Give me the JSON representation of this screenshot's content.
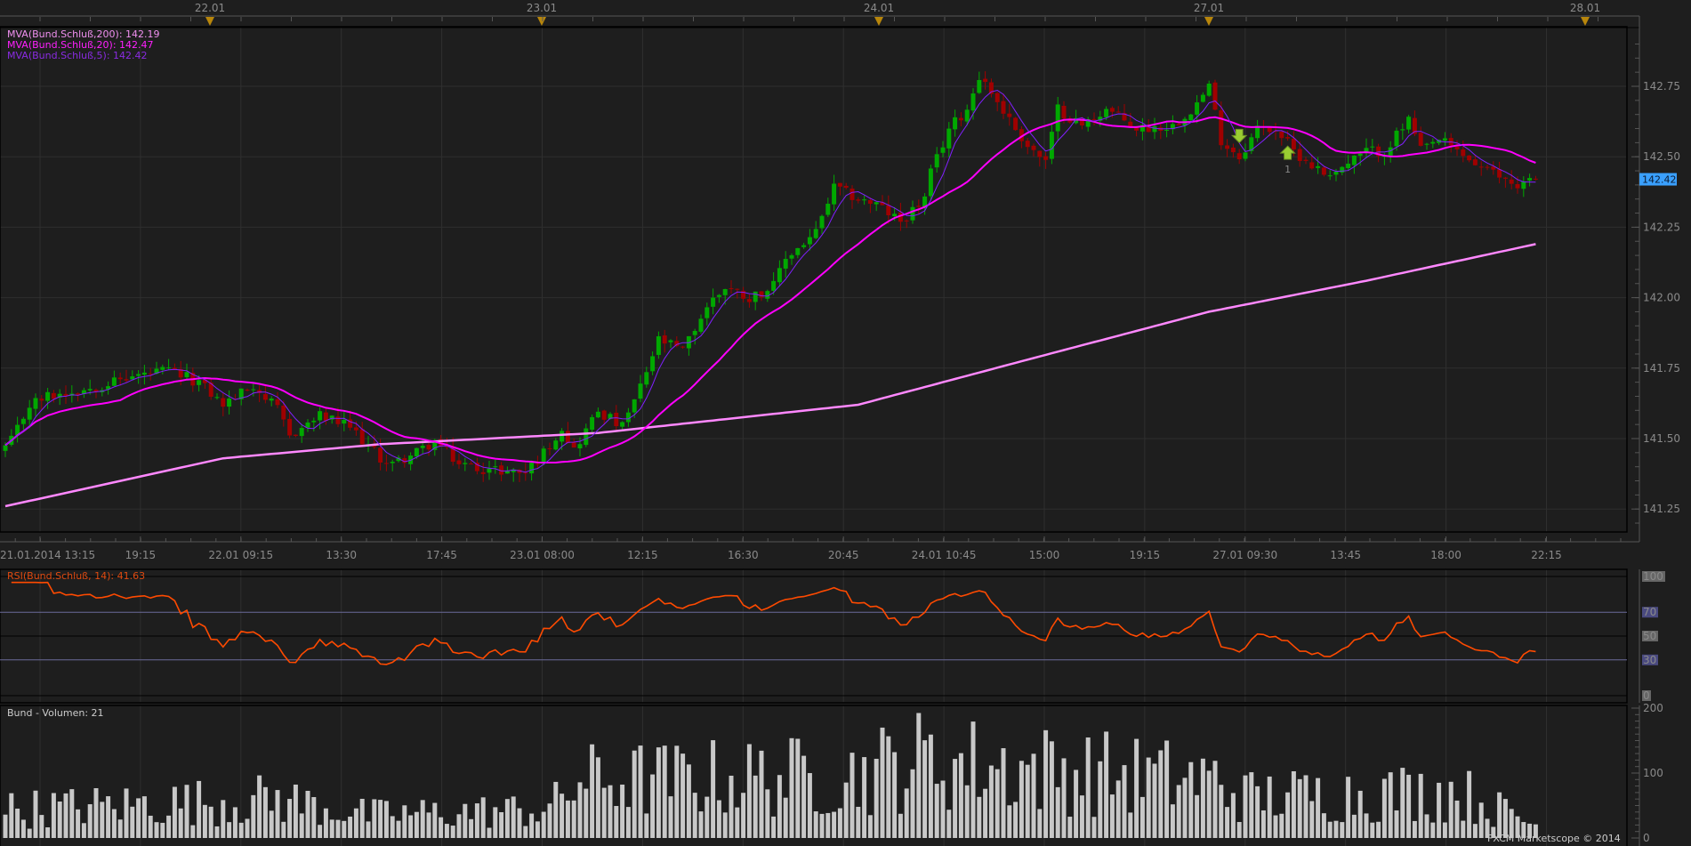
{
  "chart_data": {
    "type": "candlestick",
    "instrument": "Bund",
    "top_dates": [
      "22.01",
      "23.01",
      "24.01",
      "27.01",
      "28.01"
    ],
    "time_labels": [
      "21.01.2014 13:15",
      "19:15",
      "22.01 09:15",
      "13:30",
      "17:45",
      "23.01 08:00",
      "12:15",
      "16:30",
      "20:45",
      "24.01 10:45",
      "15:00",
      "19:15",
      "27.01 09:30",
      "13:45",
      "18:00",
      "22:15"
    ],
    "price_axis": {
      "ticks": [
        "142.75",
        "142.50",
        "142.25",
        "142.00",
        "141.75",
        "141.50",
        "141.25"
      ],
      "min": 141.17,
      "max": 142.94
    },
    "current_price": "142.42",
    "candle_count": 254,
    "close_keypoints": [
      [
        0,
        141.47
      ],
      [
        1,
        141.49
      ],
      [
        4,
        141.62
      ],
      [
        7,
        141.65
      ],
      [
        14,
        141.68
      ],
      [
        21,
        141.72
      ],
      [
        27,
        141.74
      ],
      [
        32,
        141.7
      ],
      [
        36,
        141.62
      ],
      [
        41,
        141.69
      ],
      [
        45,
        141.6
      ],
      [
        47,
        141.51
      ],
      [
        52,
        141.58
      ],
      [
        57,
        141.54
      ],
      [
        62,
        141.43
      ],
      [
        64,
        141.41
      ],
      [
        68,
        141.45
      ],
      [
        71,
        141.49
      ],
      [
        75,
        141.41
      ],
      [
        80,
        141.39
      ],
      [
        86,
        141.38
      ],
      [
        89,
        141.45
      ],
      [
        92,
        141.54
      ],
      [
        94,
        141.46
      ],
      [
        98,
        141.6
      ],
      [
        102,
        141.54
      ],
      [
        105,
        141.68
      ],
      [
        108,
        141.85
      ],
      [
        112,
        141.81
      ],
      [
        116,
        141.97
      ],
      [
        119,
        142.04
      ],
      [
        123,
        142.0
      ],
      [
        127,
        142.04
      ],
      [
        129,
        142.14
      ],
      [
        134,
        142.23
      ],
      [
        137,
        142.39
      ],
      [
        141,
        142.35
      ],
      [
        144,
        142.33
      ],
      [
        148,
        142.27
      ],
      [
        152,
        142.35
      ],
      [
        153,
        142.44
      ],
      [
        156,
        142.6
      ],
      [
        159,
        142.67
      ],
      [
        161,
        142.79
      ],
      [
        163,
        142.73
      ],
      [
        166,
        142.63
      ],
      [
        169,
        142.54
      ],
      [
        172,
        142.48
      ],
      [
        174,
        142.67
      ],
      [
        178,
        142.61
      ],
      [
        182,
        142.67
      ],
      [
        187,
        142.6
      ],
      [
        193,
        142.61
      ],
      [
        197,
        142.69
      ],
      [
        199,
        142.75
      ],
      [
        201,
        142.56
      ],
      [
        204,
        142.5
      ],
      [
        207,
        142.6
      ],
      [
        210,
        142.6
      ],
      [
        213,
        142.52
      ],
      [
        218,
        142.44
      ],
      [
        221,
        142.46
      ],
      [
        225,
        142.52
      ],
      [
        228,
        142.52
      ],
      [
        232,
        142.63
      ],
      [
        234,
        142.52
      ],
      [
        237,
        142.56
      ],
      [
        240,
        142.52
      ],
      [
        244,
        142.46
      ],
      [
        250,
        142.4
      ],
      [
        253,
        142.43
      ]
    ],
    "ma200_keypoints": [
      [
        0,
        141.26
      ],
      [
        36,
        141.43
      ],
      [
        62,
        141.48
      ],
      [
        98,
        141.52
      ],
      [
        141,
        141.62
      ],
      [
        169,
        141.78
      ],
      [
        199,
        141.95
      ],
      [
        225,
        142.06
      ],
      [
        253,
        142.19
      ]
    ],
    "legend": [
      {
        "label": "MVA(Bund.Schluß,200): 142.19",
        "color": "#f090f0"
      },
      {
        "label": "MVA(Bund.Schluß,20): 142.47",
        "color": "#ff20ff"
      },
      {
        "label": "MVA(Bund.Schluß,5): 142.42",
        "color": "#8a2be2"
      }
    ],
    "signals": [
      {
        "type": "sell",
        "index": 204
      },
      {
        "type": "buy",
        "index": 212,
        "label": "1"
      }
    ],
    "rsi": {
      "label": "RSI(Bund.Schluß, 14): 41.63",
      "ticks": [
        "100",
        "70",
        "50",
        "30",
        "0"
      ],
      "period": 14
    },
    "volume": {
      "label": "Bund - Volumen: 21",
      "ticks": [
        "200",
        "100",
        "0"
      ],
      "last": 21,
      "profile": [
        [
          0,
          55
        ],
        [
          45,
          75
        ],
        [
          60,
          45
        ],
        [
          90,
          55
        ],
        [
          95,
          110
        ],
        [
          140,
          120
        ],
        [
          150,
          150
        ],
        [
          200,
          110
        ],
        [
          205,
          80
        ],
        [
          240,
          90
        ],
        [
          253,
          25
        ]
      ]
    },
    "colors": {
      "up": "#00a800",
      "down": "#a00000",
      "ma200": "#ff88ff",
      "ma20": "#ff00ff",
      "ma5": "#8020ff",
      "rsi": "#ff4a00",
      "volume": "#c8c8c8",
      "badge": "#3aa0ff"
    }
  },
  "footer": "FXCM Marketscope © 2014"
}
